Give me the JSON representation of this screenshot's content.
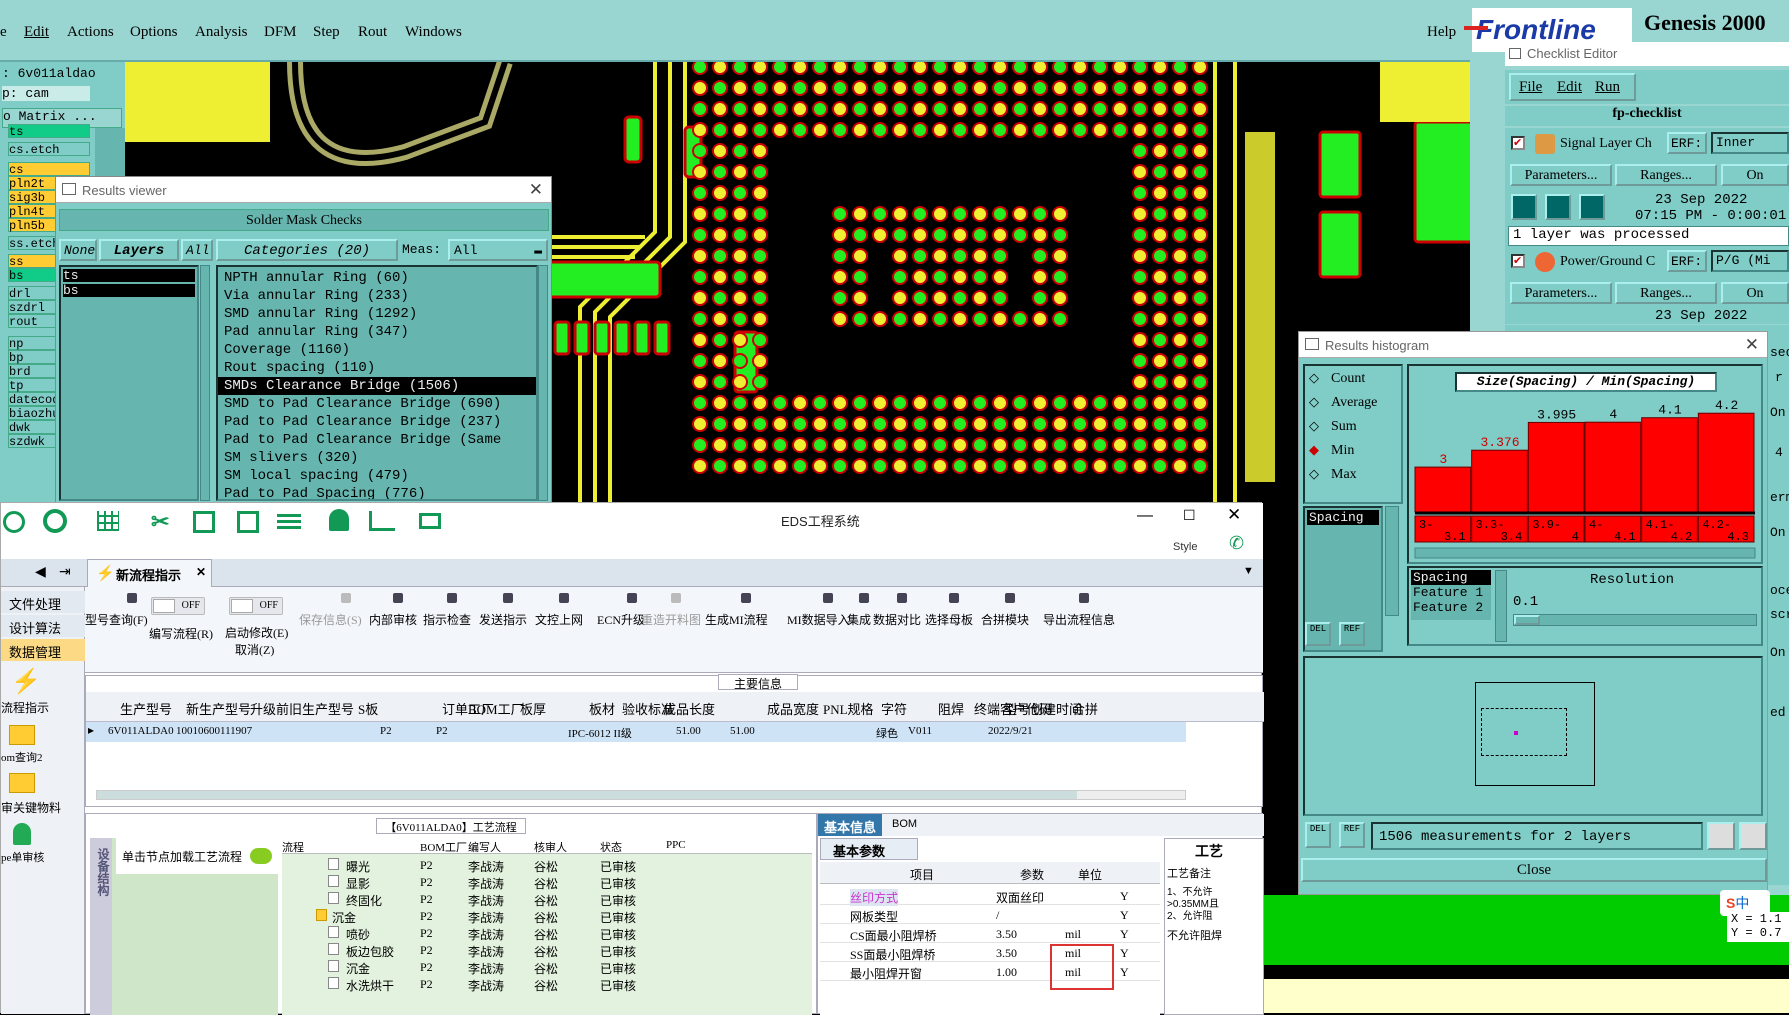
{
  "genesis": {
    "menu": [
      "e",
      "Edit",
      "Actions",
      "Options",
      "Analysis",
      "DFM",
      "Step",
      "Rout",
      "Windows"
    ],
    "help": "Help",
    "brand": "Frontline",
    "product": "Genesis 2000",
    "job_line": ": 6v011aldao",
    "step_line": "p: cam",
    "matrix_btn": "o Matrix ...",
    "layers": [
      "ts",
      "cs.etch",
      "cs",
      "pln2t",
      "sig3b",
      "pln4t",
      "pln5b",
      "ss.etch",
      "ss",
      "bs",
      "drl",
      "szdrl",
      "rout",
      "np",
      "bp",
      "brd",
      "tp",
      "datecode",
      "biaozhu",
      "dwk",
      "szdwk"
    ]
  },
  "results_viewer": {
    "title": "Results viewer",
    "header": "Solder Mask Checks",
    "btn_none": "None",
    "btn_layers": "Layers",
    "btn_all": "All",
    "categories_label": "Categories (20)",
    "meas_label": "Meas:",
    "meas_value": "All",
    "layer_items": [
      "ts",
      "bs"
    ],
    "categories": [
      "NPTH annular Ring (60)",
      "Via annular Ring (233)",
      "SMD annular Ring (1292)",
      "Pad annular Ring (347)",
      "Coverage (1160)",
      "Rout spacing (110)",
      "SMDs Clearance Bridge (1506)",
      "SMD to Pad Clearance Bridge (690)",
      "Pad to Pad Clearance Bridge (237)",
      "Pad to Pad Clearance Bridge (Same",
      "SM slivers (320)",
      "SM local spacing (479)",
      "Pad to Pad Spacing (776)"
    ],
    "selected_index": 6
  },
  "checklist": {
    "title": "Checklist Editor",
    "menu": [
      "File",
      "Edit",
      "Run"
    ],
    "name": "fp-checklist",
    "item1_name": "Signal Layer Ch",
    "item1_erf": "ERF:",
    "item1_erf_value": "Inner",
    "params": "Parameters...",
    "ranges": "Ranges...",
    "on": "On",
    "date": "23 Sep 2022",
    "time": "07:15 PM - 0:00:01",
    "status": "1 layer was processed",
    "item2_name": "Power/Ground C",
    "item2_erf_value": "P/G (Mi",
    "date2": "23 Sep 2022",
    "right_frag": [
      "sed",
      "r",
      "On",
      "4",
      "erm",
      "On",
      "oce",
      "scr",
      "On",
      "ed"
    ]
  },
  "histogram": {
    "title": "Results histogram",
    "modes": [
      "Count",
      "Average",
      "Sum",
      "Min",
      "Max"
    ],
    "selected_mode": "Min",
    "list_item": "Spacing",
    "chart_title": "Size(Spacing) / Min(Spacing)",
    "feature_list": [
      "Spacing",
      "Feature 1",
      "Feature 2"
    ],
    "resolution_label": "Resolution",
    "resolution_value": "0.1",
    "del": "DEL",
    "ref": "REF",
    "status": "1506 measurements for 2 layers",
    "close": "Close"
  },
  "chart_data": {
    "type": "bar",
    "title": "Size(Spacing) / Min(Spacing)",
    "categories": [
      "3-3.1",
      "3.3-3.4",
      "3.9-4",
      "4-4.1",
      "4.1-4.2",
      "4.2-4.3"
    ],
    "values": [
      3,
      3.376,
      3.995,
      4,
      4.1,
      4.2
    ],
    "value_labels": [
      "3",
      "3.376",
      "3.995",
      "4",
      "4.1",
      "4.2"
    ],
    "bar_color": "#ff0000"
  },
  "eds": {
    "title": "EDS工程系统",
    "style": "Style",
    "tab": "新流程指示",
    "sidebar": [
      "文件处理",
      "设计算法",
      "数据管理"
    ],
    "side_icons": [
      "流程指示",
      "om查询2",
      "审关键物料",
      "pe单审核"
    ],
    "toolbar": [
      "型号查询(F)",
      "编写流程(R)",
      "启动修改(E)",
      "取消(Z)",
      "保存信息(S)",
      "内部审核",
      "指示检查",
      "发送指示",
      "文控上网",
      "ECN升级",
      "重造开料图",
      "生成MI流程",
      "MI数据导入",
      "集成",
      "数据对比",
      "选择母板",
      "合拼模块",
      "导出流程信息"
    ],
    "off": "OFF",
    "main_info": "主要信息",
    "columns": [
      "生产型号",
      "新生产型号",
      "升级前旧生产型号",
      "S板",
      "订单工厂",
      "BOM工厂",
      "板厚",
      "板材",
      "验收标准",
      "成品长度",
      "成品宽度",
      "PNL规格",
      "字符",
      "阻焊",
      "终端客户代码",
      "型号创建时间",
      "合拼"
    ],
    "row": [
      "6V011ALDA0",
      "10010600111907",
      "",
      "",
      "P2",
      "P2",
      "",
      "",
      "IPC-6012 II级",
      "51.00",
      "51.00",
      "",
      "",
      "绿色",
      "V011",
      "2022/9/21"
    ],
    "flow_title": "【6V011ALDA0】工艺流程",
    "flow_hint": "单击节点加载工艺流程",
    "vertical_label": "设备结构",
    "flow_cols": [
      "流程",
      "BOM工厂",
      "编写人",
      "核审人",
      "状态",
      "PPC"
    ],
    "flow_rows": [
      [
        "曝光",
        "P2",
        "李战涛",
        "谷松",
        "已审核"
      ],
      [
        "显影",
        "P2",
        "李战涛",
        "谷松",
        "已审核"
      ],
      [
        "终固化",
        "P2",
        "李战涛",
        "谷松",
        "已审核"
      ],
      [
        "沉金",
        "P2",
        "李战涛",
        "谷松",
        "已审核"
      ],
      [
        "喷砂",
        "P2",
        "李战涛",
        "谷松",
        "已审核"
      ],
      [
        "板边包胶",
        "P2",
        "李战涛",
        "谷松",
        "已审核"
      ],
      [
        "沉金",
        "P2",
        "李战涛",
        "谷松",
        "已审核"
      ],
      [
        "水洗烘干",
        "P2",
        "李战涛",
        "谷松",
        "已审核"
      ]
    ],
    "basic_tab": "基本信息",
    "bom_tab": "BOM",
    "basic_params": "基本参数",
    "param_cols": [
      "项目",
      "参数",
      "单位"
    ],
    "params": [
      [
        "丝印方式",
        "双面丝印",
        "",
        "Y"
      ],
      [
        "网板类型",
        "/",
        "",
        "Y"
      ],
      [
        "CS面最小阻焊桥",
        "3.50",
        "mil",
        "Y"
      ],
      [
        "SS面最小阻焊桥",
        "3.50",
        "mil",
        "Y"
      ],
      [
        "最小阻焊开窗",
        "1.00",
        "mil",
        "Y"
      ]
    ],
    "process_label": "工艺",
    "process_note": "工艺备注",
    "note_lines": [
      "1、不允许",
      ">0.35MM且",
      "2、允许阻",
      "不允许阻焊"
    ]
  },
  "coords": {
    "x": "X = 1.1",
    "y": "Y = 0.7"
  },
  "ime": "中"
}
